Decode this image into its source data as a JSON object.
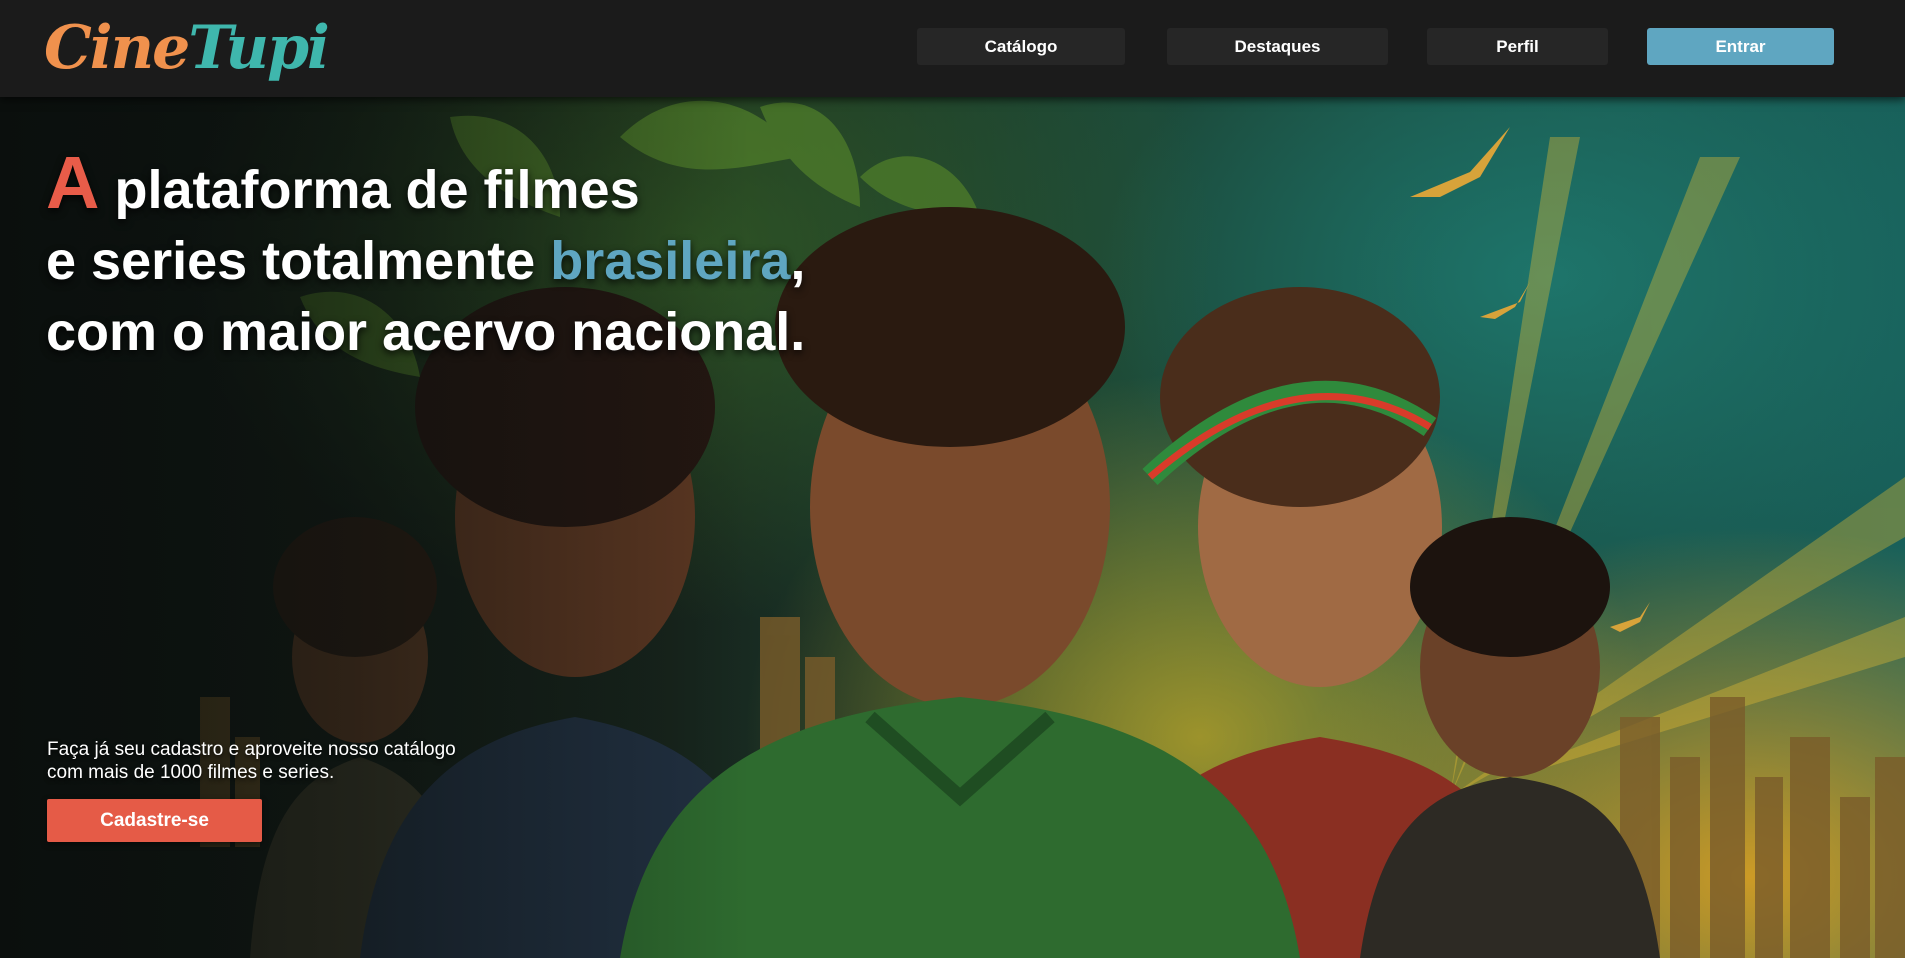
{
  "header": {
    "logo": {
      "part1": "Cine",
      "part2": "Tupi"
    },
    "nav": {
      "catalogo": "Catálogo",
      "destaques": "Destaques",
      "perfil": "Perfil",
      "entrar": "Entrar"
    }
  },
  "hero": {
    "headline": {
      "big_letter": "A",
      "line1_rest": " plataforma de filmes",
      "line2_start": "e series totalmente ",
      "accent_word": "brasileira",
      "line2_end": ",",
      "line3": "com o maior acervo nacional."
    },
    "cta_line1": "Faça já seu cadastro e aproveite nosso catálogo",
    "cta_line2": "com mais de 1000 filmes e series.",
    "cta_button": "Cadastre-se"
  },
  "colors": {
    "header_bg": "#1b1b1b",
    "nav_button_bg": "#262626",
    "entrar_button_bg": "#5fa6c1",
    "accent_red": "#e85c49",
    "accent_blue": "#5fa6c1",
    "logo_orange": "#f0914d",
    "logo_teal": "#3fb7ad"
  }
}
